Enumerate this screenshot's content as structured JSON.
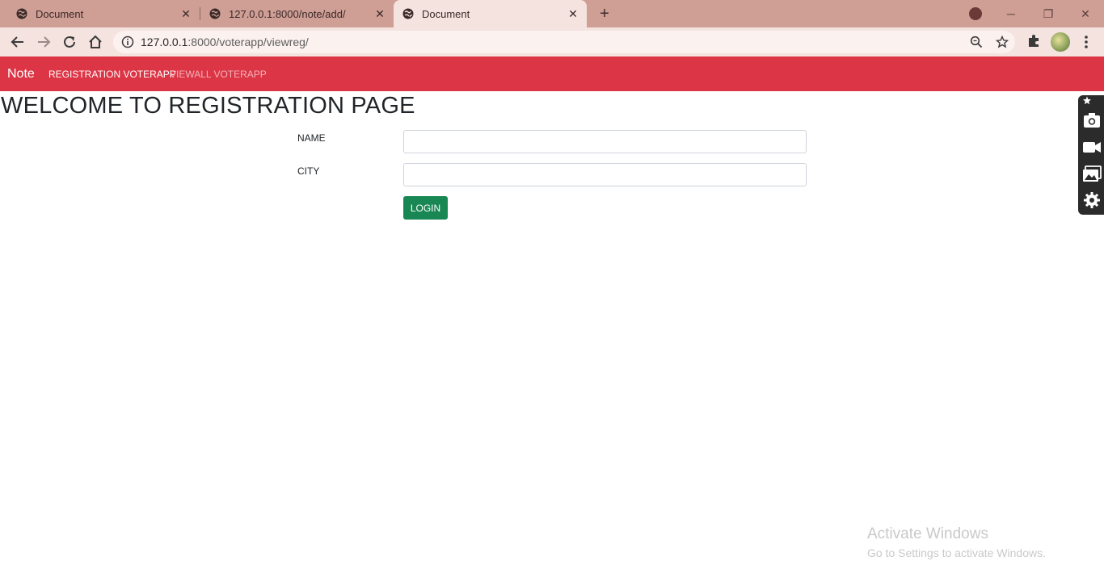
{
  "browser": {
    "tabs": [
      {
        "title": "Document",
        "active": false
      },
      {
        "title": "127.0.0.1:8000/note/add/",
        "active": false
      },
      {
        "title": "Document",
        "active": true
      }
    ],
    "url_host": "127.0.0.1",
    "url_rest": ":8000/voterapp/viewreg/",
    "accent_color": "#cf9e95"
  },
  "navbar": {
    "brand": "Note",
    "links": [
      {
        "label": "REGISTRATION VOTERAPP",
        "active": true
      },
      {
        "label": "VIEWALL VOTERAPP",
        "active": false
      }
    ],
    "color": "#dc3545"
  },
  "page": {
    "heading": "WELCOME TO REGISTRATION PAGE"
  },
  "form": {
    "name_label": "NAME",
    "name_value": "",
    "city_label": "CITY",
    "city_value": "",
    "submit_label": "LOGIN",
    "submit_color": "#198754"
  },
  "side_toolbar": {
    "icons": [
      "pin-icon",
      "camera-icon",
      "video-icon",
      "gallery-icon",
      "settings-icon"
    ]
  },
  "watermark": {
    "title": "Activate Windows",
    "subtitle": "Go to Settings to activate Windows."
  }
}
